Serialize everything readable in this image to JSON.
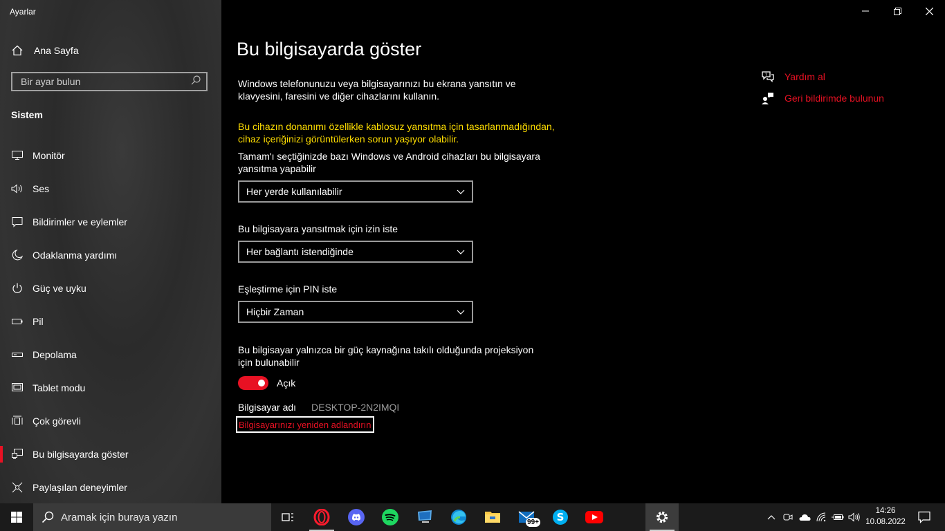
{
  "window": {
    "title": "Ayarlar"
  },
  "sidebar": {
    "home_label": "Ana Sayfa",
    "search_placeholder": "Bir ayar bulun",
    "section_title": "Sistem",
    "items": [
      {
        "label": "Monitör",
        "icon": "monitor-icon"
      },
      {
        "label": "Ses",
        "icon": "speaker-icon"
      },
      {
        "label": "Bildirimler ve eylemler",
        "icon": "notification-icon"
      },
      {
        "label": "Odaklanma yardımı",
        "icon": "moon-icon"
      },
      {
        "label": "Güç ve uyku",
        "icon": "power-icon"
      },
      {
        "label": "Pil",
        "icon": "battery-icon"
      },
      {
        "label": "Depolama",
        "icon": "storage-icon"
      },
      {
        "label": "Tablet modu",
        "icon": "tablet-icon"
      },
      {
        "label": "Çok görevli",
        "icon": "multitasking-icon"
      },
      {
        "label": "Bu bilgisayarda göster",
        "icon": "project-icon",
        "active": true
      },
      {
        "label": "Paylaşılan deneyimler",
        "icon": "shared-icon"
      }
    ]
  },
  "main": {
    "title": "Bu bilgisayarda göster",
    "description": "Windows telefonunuzu veya bilgisayarınızı bu ekrana yansıtın ve klavyesini, faresini ve diğer cihazlarını kullanın.",
    "warning": "Bu cihazın donanımı özellikle kablosuz yansıtma için tasarlanmadığından, cihaz içeriğinizi görüntülerken sorun yaşıyor olabilir.",
    "setting1_label": "Tamam'ı seçtiğinizde bazı Windows ve Android cihazları bu bilgisayara yansıtma yapabilir",
    "setting1_value": "Her yerde kullanılabilir",
    "setting2_label": "Bu bilgisayara yansıtmak için izin iste",
    "setting2_value": "Her bağlantı istendiğinde",
    "setting3_label": "Eşleştirme için PIN iste",
    "setting3_value": "Hiçbir Zaman",
    "setting4_label": "Bu bilgisayar yalnızca bir güç kaynağına takılı olduğunda projeksiyon için bulunabilir",
    "toggle_state": "Açık",
    "pc_name_label": "Bilgisayar adı",
    "pc_name_value": "DESKTOP-2N2IMQI",
    "rename_link": "Bilgisayarınızı yeniden adlandırın"
  },
  "help": {
    "get_help": "Yardım al",
    "feedback": "Geri bildirimde bulunun"
  },
  "taskbar": {
    "search_placeholder": "Aramak için buraya yazın",
    "mail_badge": "99+",
    "time": "14:26",
    "date": "10.08.2022"
  },
  "colors": {
    "accent": "#e81123",
    "warning": "#ffde00"
  }
}
